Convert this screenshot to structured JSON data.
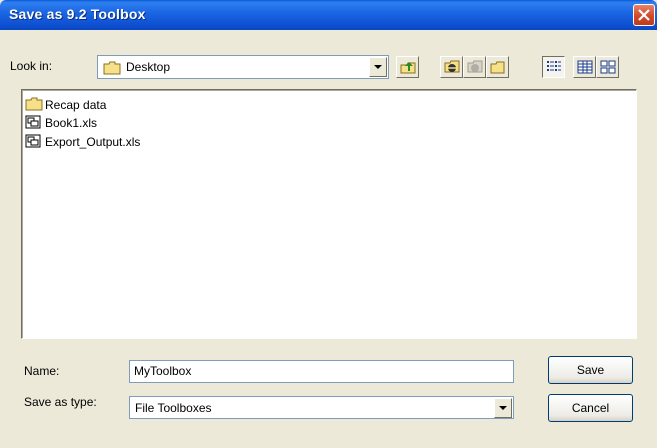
{
  "window": {
    "title": "Save as 9.2 Toolbox"
  },
  "lookin": {
    "label": "Look in:",
    "value": "Desktop"
  },
  "toolbar": {
    "buttons": [
      {
        "name": "up-one-level-icon"
      },
      {
        "name": "connect-folder-icon"
      },
      {
        "name": "disconnect-folder-icon"
      },
      {
        "name": "new-folder-icon"
      },
      {
        "name": "list-view-icon"
      },
      {
        "name": "details-view-icon"
      },
      {
        "name": "thumbnails-view-icon"
      }
    ]
  },
  "files": [
    {
      "name": "Recap data",
      "icon": "folder-icon"
    },
    {
      "name": "Book1.xls",
      "icon": "file-icon"
    },
    {
      "name": "Export_Output.xls",
      "icon": "file-icon"
    }
  ],
  "form": {
    "name_label": "Name:",
    "name_value": "MyToolbox",
    "type_label": "Save as type:",
    "type_value": "File Toolboxes"
  },
  "buttons": {
    "save": "Save",
    "cancel": "Cancel"
  },
  "colors": {
    "titlebar": "#0a5ad9",
    "close": "#cf4a2a",
    "dialog_bg": "#ece9d8"
  }
}
